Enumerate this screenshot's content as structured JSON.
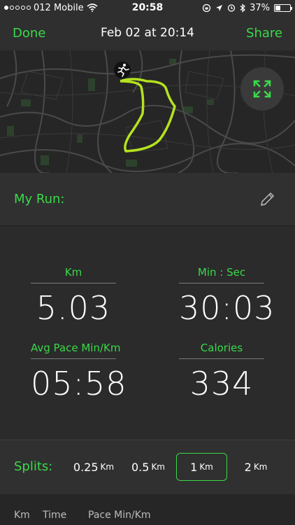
{
  "status_bar": {
    "carrier": "012 Mobile",
    "time": "20:58",
    "battery": "37%",
    "battery_level": 0.37
  },
  "nav": {
    "done_label": "Done",
    "title": "Feb 02 at 20:14",
    "share_label": "Share"
  },
  "run": {
    "label": "My Run:"
  },
  "stats": {
    "distance": {
      "label": "Km",
      "value": "5.03"
    },
    "duration": {
      "label": "Min : Sec",
      "value": "30:03"
    },
    "pace": {
      "label": "Avg Pace Min/Km",
      "value": "05:58"
    },
    "calories": {
      "label": "Calories",
      "value": "334"
    }
  },
  "splits": {
    "label": "Splits:",
    "options": [
      {
        "value": "0.25",
        "unit": "Km"
      },
      {
        "value": "0.5",
        "unit": "Km"
      },
      {
        "value": "1",
        "unit": "Km"
      },
      {
        "value": "2",
        "unit": "Km"
      }
    ],
    "selected": "1"
  },
  "table": {
    "headers": [
      "Km",
      "Time",
      "Pace Min/Km"
    ]
  },
  "colors": {
    "accent": "#3ad94a",
    "route": "#b4e31e",
    "background": "#2b2b2b"
  }
}
